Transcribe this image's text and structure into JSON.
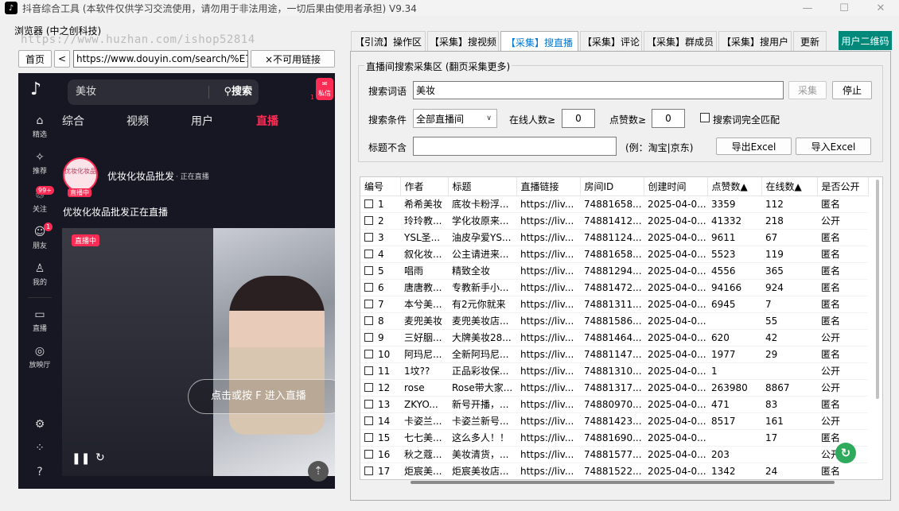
{
  "window": {
    "title": "抖音综合工具  (本软件仅供学习交流使用，请勿用于非法用途，一切后果由使用者承担)  V9.34",
    "minimize": "—",
    "maximize": "☐",
    "close": "✕"
  },
  "browser_group": {
    "label": "浏览器 (中之创科技)",
    "watermark": "https://www.huzhan.com/ishop52814",
    "home_button": "首页",
    "back_button": "<",
    "url": "https://www.douyin.com/search/%E7%",
    "unavailable_button": "×不可用链接"
  },
  "douyin": {
    "search_value": "美妆",
    "search_button": "搜索",
    "message_label": "私信",
    "message_count": "1",
    "sidebar": [
      {
        "label": "精选",
        "icon": "home-icon"
      },
      {
        "label": "推荐",
        "icon": "sparkle-icon"
      },
      {
        "label": "关注",
        "icon": "follow-icon",
        "badge": "99+"
      },
      {
        "label": "朋友",
        "icon": "friends-icon",
        "badge": "1"
      },
      {
        "label": "我的",
        "icon": "profile-icon"
      },
      {
        "label": "直播",
        "icon": "tv-icon"
      },
      {
        "label": "放映厅",
        "icon": "gamepad-icon"
      }
    ],
    "tabs": [
      "综合",
      "视频",
      "用户",
      "直播"
    ],
    "active_tab": "直播",
    "avatar_text": "优妆化妆品",
    "live_tag": "直播中",
    "anchor_name": "优妆化妆品批发",
    "anchor_status": "· 正在直播",
    "live_title": "优妆化妆品批发正在直播",
    "video_badge": "直播中",
    "click_hint": "点击或按 F 进入直播"
  },
  "right_tabs": [
    {
      "label": "【引流】操作区"
    },
    {
      "label": "【采集】搜视频"
    },
    {
      "label": "【采集】搜直播",
      "active": true
    },
    {
      "label": "【采集】评论"
    },
    {
      "label": "【采集】群成员"
    },
    {
      "label": "【采集】搜用户"
    },
    {
      "label": "更新"
    }
  ],
  "qr_tab": "用户二维码",
  "search_area": {
    "legend": "直播间搜索采集区 (翻页采集更多)",
    "keyword_label": "搜索词语",
    "keyword_value": "美妆",
    "collect_button": "采集",
    "stop_button": "停止",
    "condition_label": "搜索条件",
    "condition_value": "全部直播间",
    "online_label": "在线人数≥",
    "online_value": "0",
    "likes_label": "点赞数≥",
    "likes_value": "0",
    "exact_match_label": "搜索词完全匹配",
    "title_exclude_label": "标题不含",
    "title_exclude_value": "",
    "example_text": "(例：淘宝|京东)",
    "export_button": "导出Excel",
    "import_button": "导入Excel"
  },
  "table": {
    "columns": [
      "编号",
      "作者",
      "标题",
      "直播链接",
      "房间ID",
      "创建时间",
      "点赞数▲",
      "在线数▲",
      "是否公开"
    ],
    "rows": [
      [
        "1",
        "希希美妆",
        "底妆卡粉浮...",
        "https://liv...",
        "74881658...",
        "2025-04-0...",
        "3359",
        "112",
        "匿名"
      ],
      [
        "2",
        "玲玲教...",
        "学化妆原来...",
        "https://liv...",
        "74881412...",
        "2025-04-0...",
        "41332",
        "218",
        "公开"
      ],
      [
        "3",
        "YSL圣...",
        "油皮孕爱YS...",
        "https://liv...",
        "74881124...",
        "2025-04-0...",
        "9611",
        "67",
        "匿名"
      ],
      [
        "4",
        "叙化妆...",
        "公主请进来...",
        "https://liv...",
        "74881658...",
        "2025-04-0...",
        "5523",
        "119",
        "匿名"
      ],
      [
        "5",
        "唱雨",
        "精致全妆",
        "https://liv...",
        "74881294...",
        "2025-04-0...",
        "4556",
        "365",
        "匿名"
      ],
      [
        "6",
        "唐唐教...",
        "专教新手小...",
        "https://liv...",
        "74881472...",
        "2025-04-0...",
        "94166",
        "924",
        "匿名"
      ],
      [
        "7",
        "本兮美...",
        "有2元你就来",
        "https://liv...",
        "74881311...",
        "2025-04-0...",
        "6945",
        "7",
        "匿名"
      ],
      [
        "8",
        "麦兜美妆",
        "麦兜美妆店...",
        "https://liv...",
        "74881586...",
        "2025-04-0...",
        "",
        "55",
        "匿名"
      ],
      [
        "9",
        "三好胭...",
        "大牌美妆28...",
        "https://liv...",
        "74881464...",
        "2025-04-0...",
        "620",
        "42",
        "公开"
      ],
      [
        "10",
        "阿玛尼...",
        "全新阿玛尼...",
        "https://liv...",
        "74881147...",
        "2025-04-0...",
        "1977",
        "29",
        "匿名"
      ],
      [
        "11",
        "1坟??",
        "正品彩妆保...",
        "https://liv...",
        "74881310...",
        "2025-04-0...",
        "1",
        "",
        "公开"
      ],
      [
        "12",
        "rose",
        "Rose带大家...",
        "https://liv...",
        "74881317...",
        "2025-04-0...",
        "263980",
        "8867",
        "公开"
      ],
      [
        "13",
        "ZKYO...",
        "新号开播，...",
        "https://liv...",
        "74880970...",
        "2025-04-0...",
        "471",
        "83",
        "匿名"
      ],
      [
        "14",
        "卡姿兰...",
        "卡姿兰新号...",
        "https://liv...",
        "74881423...",
        "2025-04-0...",
        "8517",
        "161",
        "公开"
      ],
      [
        "15",
        "七七美...",
        "这么多人！！",
        "https://liv...",
        "74881690...",
        "2025-04-0...",
        "",
        "17",
        "匿名"
      ],
      [
        "16",
        "秋之蔻...",
        "美妆清货，...",
        "https://liv...",
        "74881577...",
        "2025-04-0...",
        "203",
        "",
        "公开"
      ],
      [
        "17",
        "炬宸美...",
        "炬宸美妆店...",
        "https://liv...",
        "74881522...",
        "2025-04-0...",
        "1342",
        "24",
        "匿名"
      ]
    ]
  }
}
